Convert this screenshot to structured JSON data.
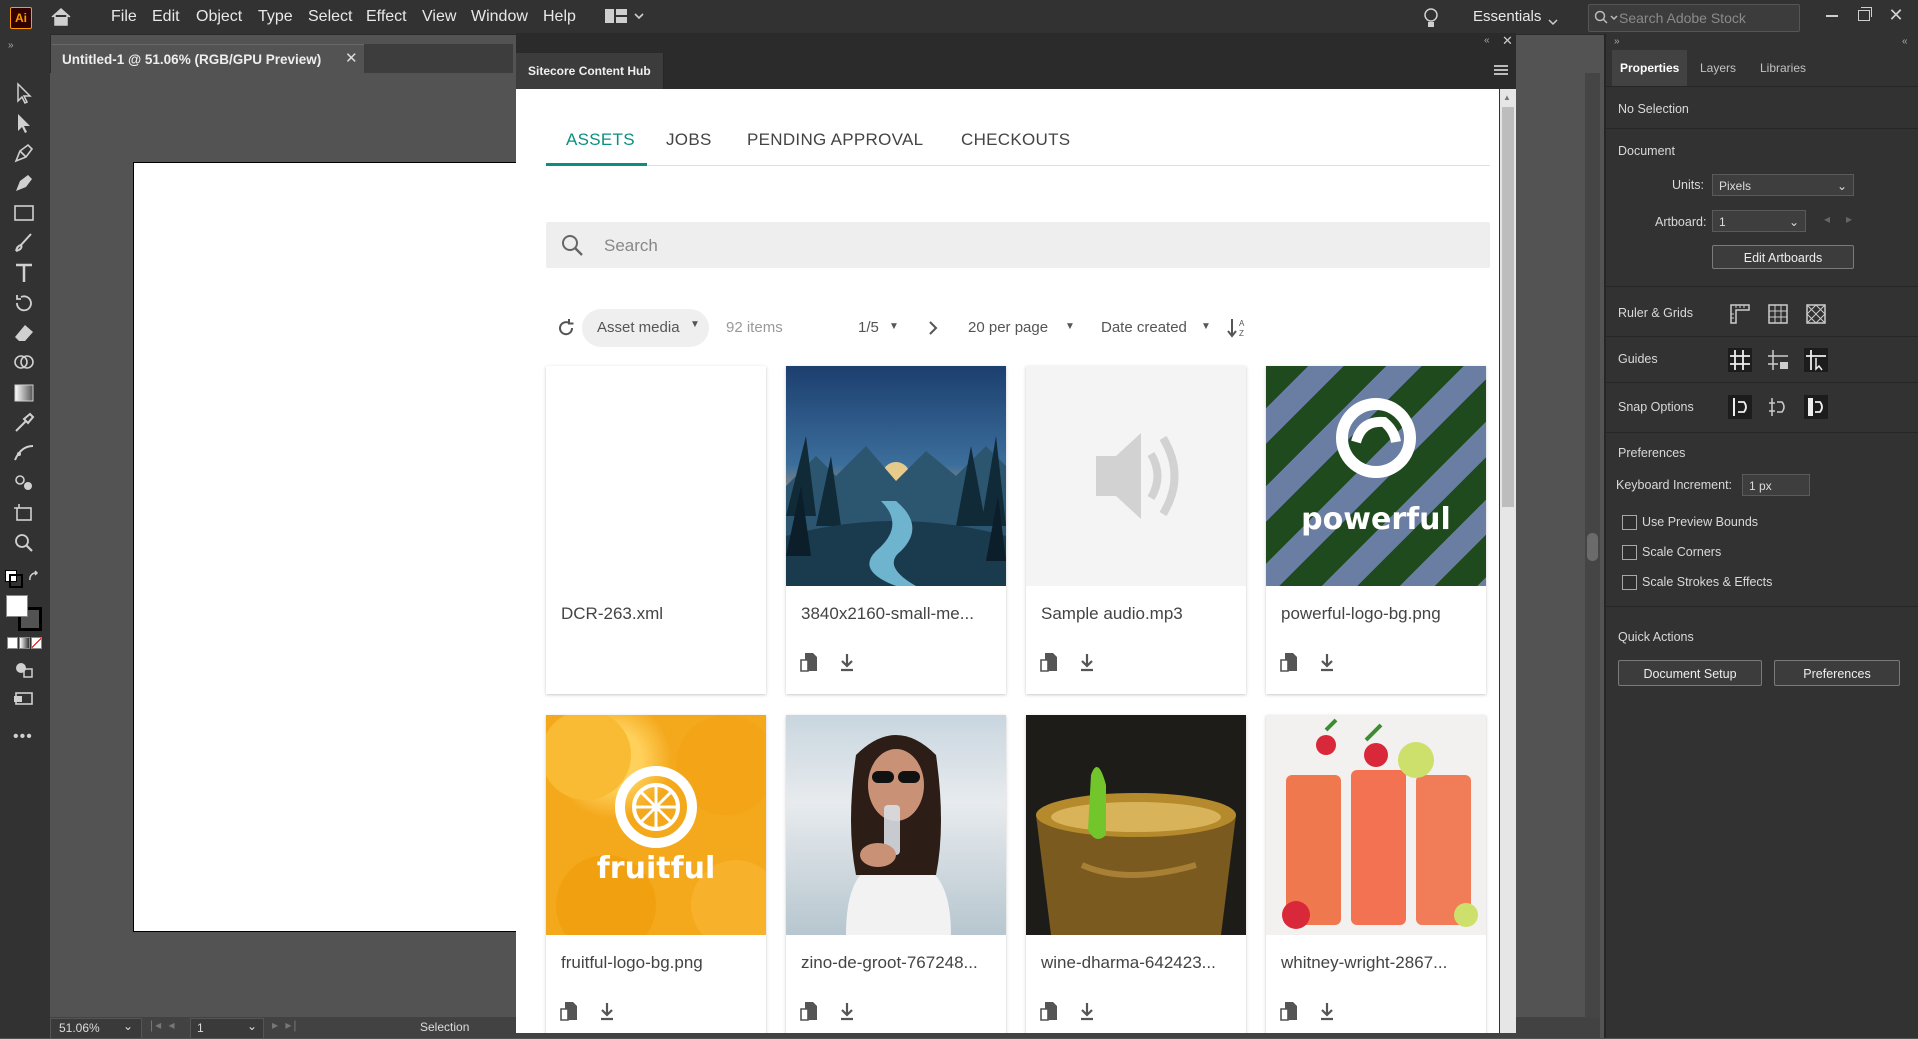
{
  "app": {
    "logo_text": "Ai",
    "menu": [
      "File",
      "Edit",
      "Object",
      "Type",
      "Select",
      "Effect",
      "View",
      "Window",
      "Help"
    ],
    "workspace": "Essentials",
    "stock_search_placeholder": "Search Adobe Stock"
  },
  "document": {
    "tab_title": "Untitled-1 @ 51.06% (RGB/GPU Preview)",
    "zoom": "51.06%",
    "artboard_number": "1",
    "status_tool": "Selection"
  },
  "properties_panel": {
    "tabs": [
      "Properties",
      "Layers",
      "Libraries"
    ],
    "selection_state": "No Selection",
    "document_section": "Document",
    "units_label": "Units:",
    "units_value": "Pixels",
    "artboard_label": "Artboard:",
    "artboard_value": "1",
    "edit_artboards": "Edit Artboards",
    "ruler_grids": "Ruler & Grids",
    "guides": "Guides",
    "snap_options": "Snap Options",
    "preferences_section": "Preferences",
    "keyboard_increment_label": "Keyboard Increment:",
    "keyboard_increment_value": "1 px",
    "checkboxes": [
      "Use Preview Bounds",
      "Scale Corners",
      "Scale Strokes & Effects"
    ],
    "quick_actions": "Quick Actions",
    "document_setup": "Document Setup",
    "preferences_button": "Preferences"
  },
  "content_hub": {
    "title": "Sitecore Content Hub",
    "tabs": [
      "ASSETS",
      "JOBS",
      "PENDING APPROVAL",
      "CHECKOUTS"
    ],
    "active_tab": "ASSETS",
    "accent_color": "#0b8f80",
    "search_placeholder": "Search",
    "filter": "Asset media",
    "item_count": "92 items",
    "page": "1/5",
    "per_page": "20 per page",
    "sort": "Date created",
    "assets": [
      {
        "name": "DCR-263.xml",
        "thumb": "blank"
      },
      {
        "name": "3840x2160-small-me...",
        "thumb": "landscape"
      },
      {
        "name": "Sample audio.mp3",
        "thumb": "audio"
      },
      {
        "name": "powerful-logo-bg.png",
        "thumb": "powerful",
        "logo_text": "powerful"
      },
      {
        "name": "fruitful-logo-bg.png",
        "thumb": "fruitful",
        "logo_text": "fruitful"
      },
      {
        "name": "zino-de-groot-767248...",
        "thumb": "woman"
      },
      {
        "name": "wine-dharma-642423...",
        "thumb": "mug"
      },
      {
        "name": "whitney-wright-2867...",
        "thumb": "drinks"
      }
    ]
  }
}
